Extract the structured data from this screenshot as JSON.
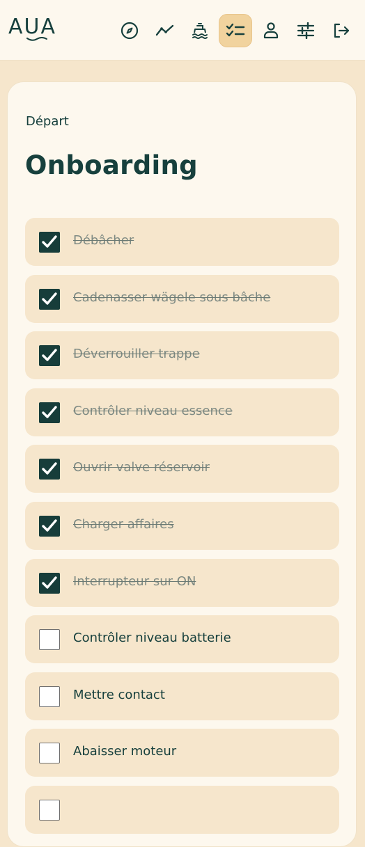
{
  "header": {
    "logo_text": "AUA",
    "nav": [
      {
        "id": "explore",
        "icon": "compass-icon",
        "active": false
      },
      {
        "id": "stats",
        "icon": "trend-line-icon",
        "active": false
      },
      {
        "id": "boat",
        "icon": "boat-icon",
        "active": false
      },
      {
        "id": "checklist",
        "icon": "checklist-icon",
        "active": true
      },
      {
        "id": "profile",
        "icon": "user-icon",
        "active": false
      },
      {
        "id": "settings",
        "icon": "sliders-icon",
        "active": false
      },
      {
        "id": "logout",
        "icon": "logout-icon",
        "active": false
      }
    ]
  },
  "page": {
    "breadcrumb": "Départ",
    "title": "Onboarding"
  },
  "tasks": [
    {
      "label": "Débâcher",
      "checked": true
    },
    {
      "label": "Cadenasser wägele sous bâche",
      "checked": true
    },
    {
      "label": "Déverrouiller trappe",
      "checked": true
    },
    {
      "label": "Contrôler niveau essence",
      "checked": true
    },
    {
      "label": "Ouvrir valve réservoir",
      "checked": true
    },
    {
      "label": "Charger affaires",
      "checked": true
    },
    {
      "label": "Interrupteur sur ON",
      "checked": true
    },
    {
      "label": "Contrôler niveau batterie",
      "checked": false
    },
    {
      "label": "Mettre contact",
      "checked": false
    },
    {
      "label": "Abaisser moteur",
      "checked": false
    },
    {
      "label": "",
      "checked": false
    }
  ],
  "colors": {
    "primary": "#17403d",
    "background": "#f6e6cc",
    "card": "#fdf8ee",
    "active_nav": "#f1d39e",
    "done_text": "#7e8a83"
  }
}
